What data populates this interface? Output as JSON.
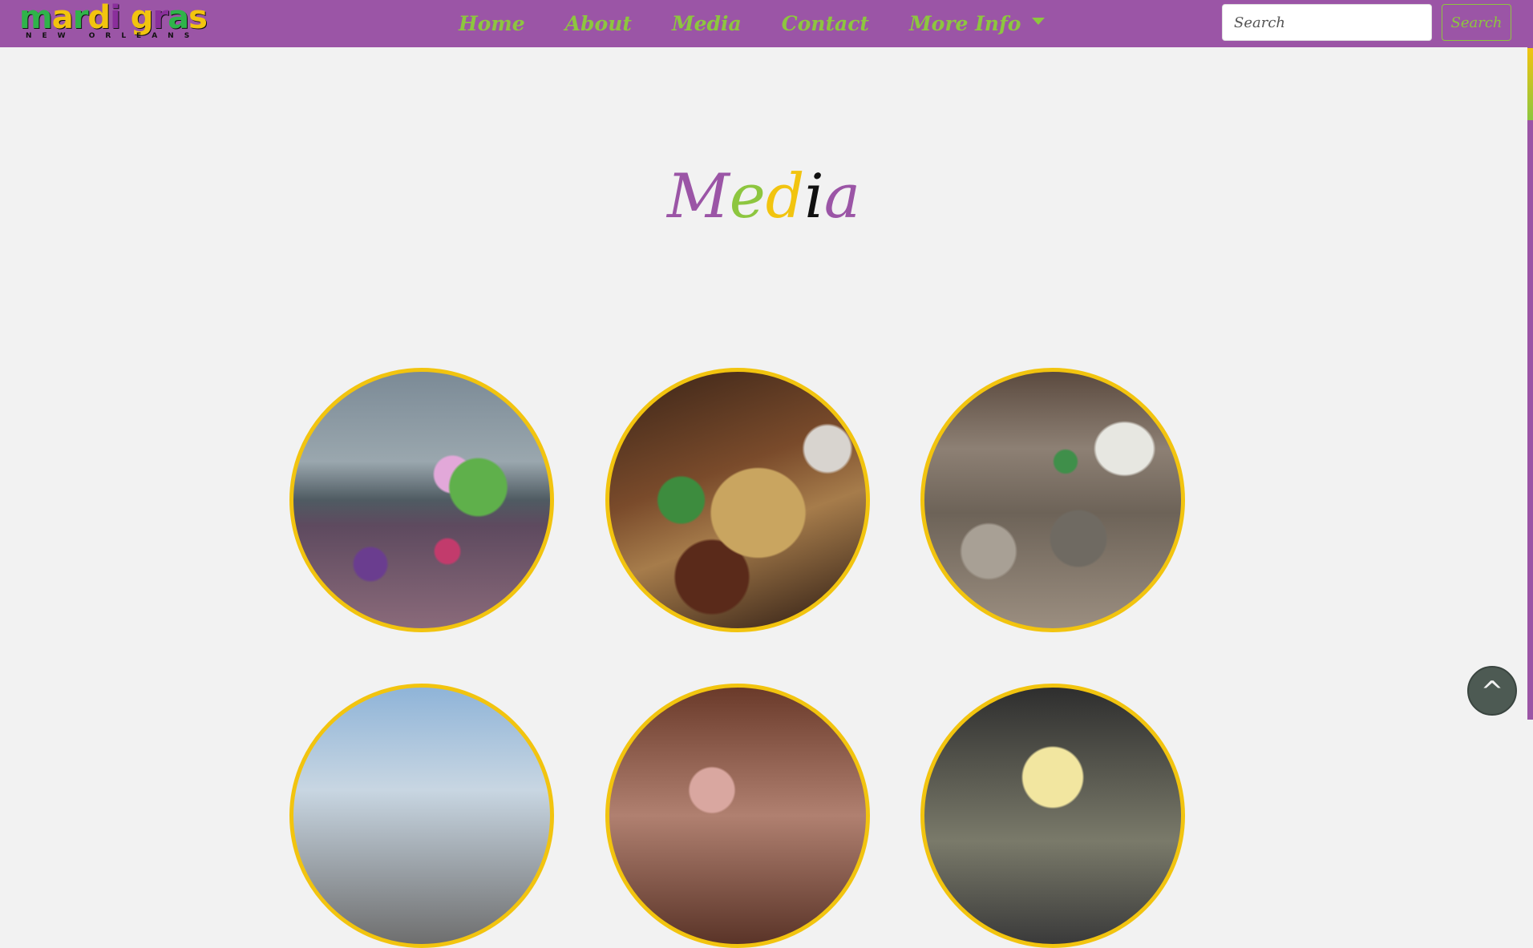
{
  "navbar": {
    "logo": {
      "main_letters": [
        "m",
        "a",
        "r",
        "d",
        "i",
        " ",
        "g",
        "r",
        "a",
        "s",
        ""
      ],
      "subtitle": "NEW ORLEANS"
    },
    "links": [
      {
        "label": "Home"
      },
      {
        "label": "About"
      },
      {
        "label": "Media"
      },
      {
        "label": "Contact"
      },
      {
        "label": "More Info"
      }
    ],
    "search": {
      "placeholder": "Search",
      "button_label": "Search"
    }
  },
  "page": {
    "title_letters": [
      "M",
      "e",
      "d",
      "i",
      "a"
    ]
  },
  "gallery": {
    "items": [
      {
        "description_icon": "parade-crowd-photo"
      },
      {
        "description_icon": "costumed-reveler-photo"
      },
      {
        "description_icon": "bourbon-street-crowd-photo"
      },
      {
        "description_icon": "balcony-photo"
      },
      {
        "description_icon": "float-photo"
      },
      {
        "description_icon": "mask-photo"
      }
    ]
  },
  "back_to_top": {
    "label": "^"
  },
  "colors": {
    "brand_purple": "#9b55a6",
    "brand_green": "#8dc63f",
    "brand_gold": "#f2c40f",
    "background": "#f2f2f2"
  }
}
